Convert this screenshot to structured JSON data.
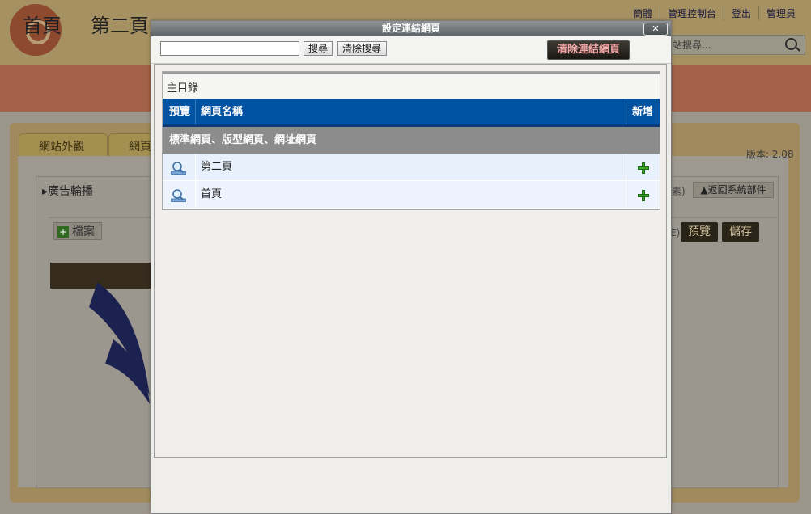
{
  "background": {
    "top_links": [
      "簡體",
      "管理控制台",
      "登出",
      "管理員"
    ],
    "search_placeholder": "站搜尋...",
    "nav_items": [
      "首頁",
      "第二頁"
    ],
    "tabs": [
      "網站外觀",
      "網頁"
    ],
    "version": "版本: 2.08",
    "box_title": "廣告輪播",
    "back_button": "▲返回系統部件",
    "file_button": "檔案",
    "preview_button": "預覽",
    "save_button": "儲存",
    "bracket_text_1": "素)",
    "bracket_text_2": "E)"
  },
  "dialog": {
    "title": "設定連結網頁",
    "close_label": "✕",
    "search": {
      "value": "",
      "placeholder": ""
    },
    "search_button": "搜尋",
    "clear_search_button": "清除搜尋",
    "clear_link_button": "清除連結網頁",
    "root_label": "主目錄",
    "columns": {
      "preview": "預覽",
      "name": "網頁名稱",
      "add": "新增"
    },
    "group_label": "標準網頁、版型網頁、網址網頁",
    "rows": [
      {
        "name": "第二頁",
        "preview_icon": "magnifier-icon",
        "add_icon": "plus-icon"
      },
      {
        "name": "首頁",
        "preview_icon": "magnifier-icon",
        "add_icon": "plus-icon"
      }
    ]
  }
}
